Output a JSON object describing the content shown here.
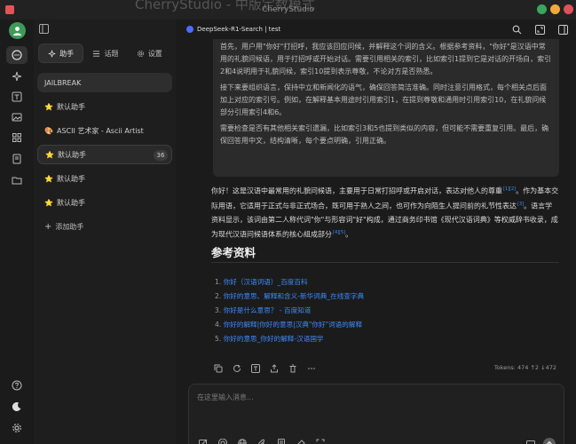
{
  "window": {
    "bg_title": "CherryStudio - 中版定数模式",
    "title": "CherryStudio",
    "controls_colors": [
      "#3aa65a",
      "#f0a93a",
      "#e0505a"
    ]
  },
  "sidebar": {
    "tabs": [
      {
        "label": "助手",
        "icon": "sparkle-icon"
      },
      {
        "label": "话题",
        "icon": "list-icon"
      },
      {
        "label": "设置",
        "icon": "gear-icon"
      }
    ],
    "assistants": [
      {
        "emoji": "",
        "label": "JAILBREAK",
        "badge": ""
      },
      {
        "emoji": "⭐",
        "label": "默认助手",
        "badge": ""
      },
      {
        "emoji": "🎨",
        "label": "ASCII 艺术家 - Ascii Artist",
        "badge": ""
      },
      {
        "emoji": "⭐",
        "label": "默认助手",
        "badge": "36"
      },
      {
        "emoji": "⭐",
        "label": "默认助手",
        "badge": ""
      },
      {
        "emoji": "⭐",
        "label": "默认助手",
        "badge": ""
      }
    ],
    "add_label": "添加助手"
  },
  "topbar": {
    "model": "DeepSeek-R1-Search | test"
  },
  "thinking": {
    "paragraphs": [
      "首先，用户用\"你好\"打招呼，我应该回应问候，并解释这个词的含义。根据参考资料，\"你好\"是汉语中常用的礼貌问候语，用于打招呼或开始对话。需要引用相关的索引，比如索引1提到它是对话的开场白，索引2和4说明用于礼貌问候，索引10提到表示尊敬，不论对方是否熟悉。",
      "接下来要组织语言，保持中立和新闻化的语气，确保回答简洁准确。同时注意引用格式，每个相关点后面加上对应的索引号。例如，在解释基本用途时引用索引1，在提到尊敬和通用时引用索引10，在礼貌问候部分引用索引4和6。",
      "需要检查是否有其他相关索引遗漏，比如索引3和5也提到类似的内容，但可能不需要重复引用。最后，确保回答用中文，结构清晰，每个要点明确，引用正确。"
    ]
  },
  "answer": {
    "segments": [
      {
        "text": "你好！这是汉语中最常用的礼貌问候语，主要用于日常打招呼或开启对话，表达对他人的尊重",
        "cite": "[1][2]"
      },
      {
        "text": "。作为基本交际用语，它适用于正式与非正式场合，既可用于熟人之间，也可作为向陌生人提问前的礼节性表达",
        "cite": "[3]"
      },
      {
        "text": "。语言学资料显示，该词由第二人称代词\"你\"与形容词\"好\"构成，通过商务印书馆《现代汉语词典》等权威辞书收录，成为现代汉语问候语体系的核心组成部分",
        "cite": "[4][5]"
      },
      {
        "text": "。",
        "cite": ""
      }
    ]
  },
  "references": {
    "title": "参考资料",
    "items": [
      "你好（汉语词语）_百度百科",
      "你好的意思、解释和含义-新华词典_在线查字典",
      "你好是什么意思？ - 百度知道",
      "你好的解释|你好的意思|汉典\"你好\"词语的解释",
      "你好的意思_你好的解释-汉语国学"
    ]
  },
  "message": {
    "tokens": "Tokens: 474 ↑2 ↓472"
  },
  "input": {
    "placeholder": "在这里输入消息..."
  }
}
